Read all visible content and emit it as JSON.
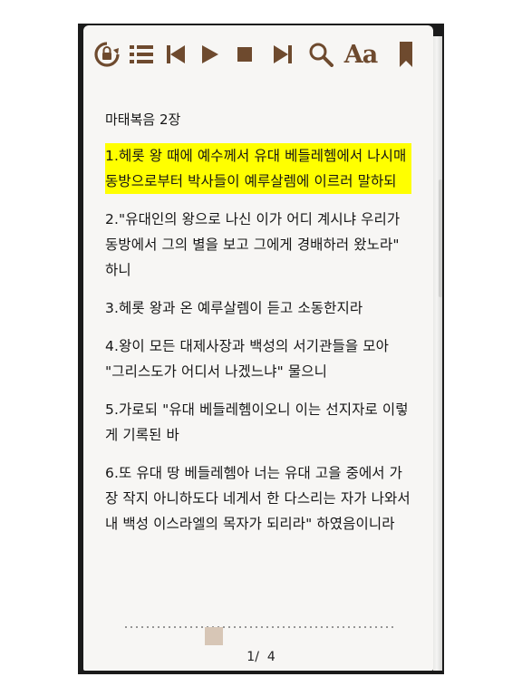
{
  "toolbar": {
    "icon_color": "#6e4a2e",
    "items": [
      {
        "name": "rotation-lock-icon"
      },
      {
        "name": "list-icon"
      },
      {
        "name": "skip-previous-icon"
      },
      {
        "name": "play-icon"
      },
      {
        "name": "stop-icon"
      },
      {
        "name": "skip-next-icon"
      },
      {
        "name": "search-icon"
      },
      {
        "name": "font-size-icon",
        "label": "Aa"
      },
      {
        "name": "bookmark-icon"
      }
    ]
  },
  "reader": {
    "chapter_title": "마태복음 2장",
    "highlight_color": "#ffff00",
    "verses": [
      "1.헤롯 왕 때에 예수께서 유대 베들레헴에서 나시매 동방으로부터 박사들이 예루살렘에 이르러 말하되",
      "2.\"유대인의 왕으로 나신 이가 어디 계시냐 우리가 동방에서 그의 별을 보고 그에게 경배하러 왔노라\" 하니",
      "3.헤롯 왕과 온 예루살렘이 듣고 소동한지라",
      "4.왕이 모든 대제사장과 백성의 서기관들을 모아 \"그리스도가 어디서 나겠느냐\" 물으니",
      "5.가로되 \"유대 베들레헴이오니 이는 선지자로 이렇게 기록된 바",
      "6.또 유대 땅 베들레헴아 너는 유대 고을 중에서 가장 작지 아니하도다 네게서 한 다스리는 자가 나와서 내 백성 이스라엘의 목자가 되리라\" 하였음이니라"
    ]
  },
  "pager": {
    "current": "1",
    "separator": "/",
    "total": "4",
    "thumb_color": "#d7c6b6",
    "position_fraction": 0.32
  }
}
